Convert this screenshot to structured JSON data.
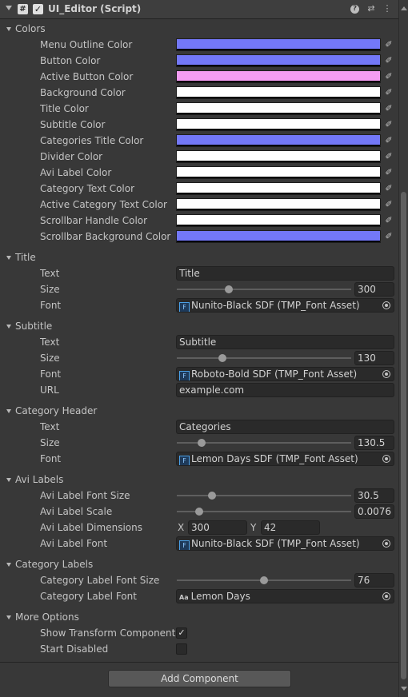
{
  "header": {
    "title": "UI_Editor (Script)",
    "script_icon": "#",
    "enabled_check": "✓",
    "help_icon": "?",
    "preset_icon": "⇄",
    "menu_icon": "⋮"
  },
  "colors": {
    "section_label": "Colors",
    "items": [
      {
        "label": "Menu Outline Color",
        "color": "#7378f8"
      },
      {
        "label": "Button Color",
        "color": "#7378f8"
      },
      {
        "label": "Active Button Color",
        "color": "#f49df2"
      },
      {
        "label": "Background Color",
        "color": "#ffffff"
      },
      {
        "label": "Title Color",
        "color": "#ffffff"
      },
      {
        "label": "Subtitle Color",
        "color": "#ffffff"
      },
      {
        "label": "Categories Title Color",
        "color": "#7378f8"
      },
      {
        "label": "Divider Color",
        "color": "#ffffff"
      },
      {
        "label": "Avi Label Color",
        "color": "#ffffff"
      },
      {
        "label": "Category Text Color",
        "color": "#ffffff"
      },
      {
        "label": "Active Category Text Color",
        "color": "#ffffff"
      },
      {
        "label": "Scrollbar Handle Color",
        "color": "#ffffff"
      },
      {
        "label": "Scrollbar Background Color",
        "color": "#7378f8"
      }
    ]
  },
  "title_section": {
    "section_label": "Title",
    "text_label": "Text",
    "text_value": "Title",
    "size_label": "Size",
    "size_value": "300",
    "size_fraction": 0.3,
    "font_label": "Font",
    "font_value": "Nunito-Black SDF (TMP_Font Asset)"
  },
  "subtitle_section": {
    "section_label": "Subtitle",
    "text_label": "Text",
    "text_value": "Subtitle",
    "size_label": "Size",
    "size_value": "130",
    "size_fraction": 0.26,
    "font_label": "Font",
    "font_value": "Roboto-Bold SDF (TMP_Font Asset)",
    "url_label": "URL",
    "url_value": "example.com"
  },
  "category_header": {
    "section_label": "Category Header",
    "text_label": "Text",
    "text_value": "Categories",
    "size_label": "Size",
    "size_value": "130.5",
    "size_fraction": 0.14,
    "font_label": "Font",
    "font_value": "Lemon Days SDF (TMP_Font Asset)"
  },
  "avi_labels": {
    "section_label": "Avi Labels",
    "font_size_label": "Avi Label Font Size",
    "font_size_value": "30.5",
    "font_size_fraction": 0.2,
    "scale_label": "Avi Label Scale",
    "scale_value": "0.0076",
    "scale_fraction": 0.13,
    "dimensions_label": "Avi Label Dimensions",
    "dim_x_label": "X",
    "dim_x_value": "300",
    "dim_y_label": "Y",
    "dim_y_value": "42",
    "font_label": "Avi Label Font",
    "font_value": "Nunito-Black SDF (TMP_Font Asset)"
  },
  "category_labels": {
    "section_label": "Category Labels",
    "font_size_label": "Category Label Font Size",
    "font_size_value": "76",
    "font_size_fraction": 0.5,
    "font_label": "Category Label Font",
    "font_value": "Lemon Days",
    "font_icon_text": "Aa"
  },
  "more_options": {
    "section_label": "More Options",
    "show_transform_label": "Show Transform Component",
    "show_transform_checked": true,
    "check_glyph": "✓",
    "start_disabled_label": "Start Disabled",
    "start_disabled_checked": false
  },
  "footer": {
    "add_component_label": "Add Component"
  },
  "icons": {
    "eyedropper": "eyedropper-icon",
    "font_asset": "font-asset-icon",
    "object_picker": "object-picker-icon"
  }
}
